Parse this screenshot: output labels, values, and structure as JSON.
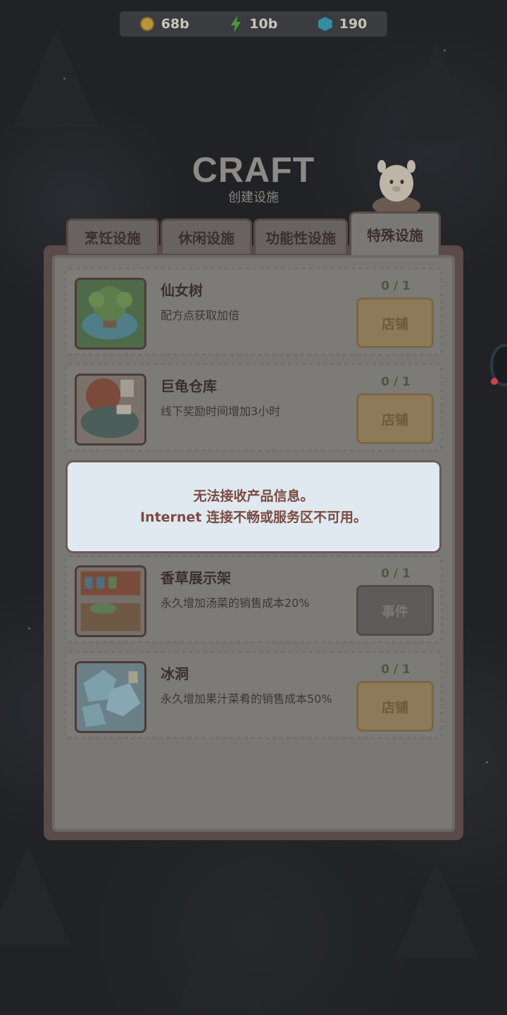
{
  "currency": {
    "coins": "68b",
    "energy": "10b",
    "gems": "190"
  },
  "header": {
    "title": "CRAFT",
    "subtitle": "创建设施"
  },
  "tabs": [
    {
      "label": "烹饪设施",
      "active": false
    },
    {
      "label": "休闲设施",
      "active": false
    },
    {
      "label": "功能性设施",
      "active": false
    },
    {
      "label": "特殊设施",
      "active": true
    }
  ],
  "facilities": [
    {
      "name": "仙女树",
      "desc": "配方点获取加倍",
      "count": "0 / 1",
      "button": "店铺",
      "icon": "fairy-tree-icon"
    },
    {
      "name": "巨龟仓库",
      "desc": "线下奖励时间增加3小时",
      "count": "0 / 1",
      "button": "店铺",
      "icon": "turtle-warehouse-icon"
    },
    {
      "name": "香草展示架",
      "desc": "永久增加汤菜的销售成本20%",
      "count": "0 / 1",
      "button": "事件",
      "icon": "herb-shelf-icon"
    },
    {
      "name": "冰洞",
      "desc": "永久增加果汁菜肴的销售成本50%",
      "count": "0 / 1",
      "button": "店铺",
      "icon": "ice-cave-icon"
    }
  ],
  "toast": {
    "line1": "无法接收产品信息。",
    "line2": "Internet 连接不畅或服务区不可用。"
  },
  "colors": {
    "accent_shop": "#8d7a59",
    "event_button": "#5d5c5a",
    "toast_bg": "#dfe9ef",
    "toast_text": "#7b4b43"
  }
}
